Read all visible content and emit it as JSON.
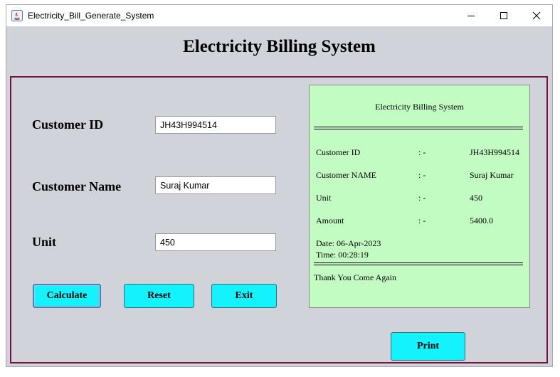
{
  "window": {
    "title": "Electricity_Bill_Generate_System"
  },
  "header": {
    "title": "Electricity Billing System"
  },
  "form": {
    "customer_id_label": "Customer ID",
    "customer_id_value": "JH43H994514",
    "customer_name_label": "Customer Name",
    "customer_name_value": "Suraj Kumar",
    "unit_label": "Unit",
    "unit_value": "450"
  },
  "buttons": {
    "calculate": "Calculate",
    "reset": "Reset",
    "exit": "Exit",
    "print": "Print"
  },
  "receipt": {
    "title": "Electricity Billing System",
    "rows": [
      {
        "label": "Customer ID",
        "sep": ": -",
        "value": "JH43H994514"
      },
      {
        "label": "Customer NAME",
        "sep": ": -",
        "value": "Suraj Kumar"
      },
      {
        "label": "Unit",
        "sep": ": -",
        "value": "450"
      },
      {
        "label": "Amount",
        "sep": ": -",
        "value": "5400.0"
      }
    ],
    "date": "Date: 06-Apr-2023",
    "time": "Time: 00:28:19",
    "footer": "Thank You Come Again"
  },
  "colors": {
    "button": "#12f3fd",
    "receipt_bg": "#c3fcc3",
    "panel_border": "#7a1040",
    "window_bg": "#d0d3da"
  },
  "icons": [
    "java-icon",
    "minimize-icon",
    "maximize-icon",
    "close-icon"
  ]
}
